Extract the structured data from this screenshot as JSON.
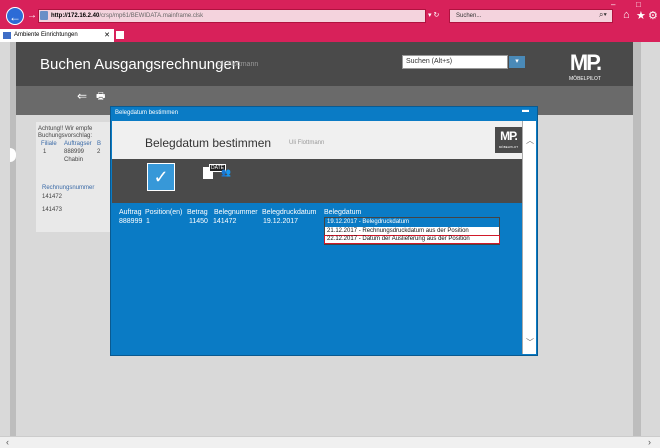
{
  "browser": {
    "address_host": "http://172.16.2.40",
    "address_path": "/crsp/mp61/BEWIDATA.mainframe.clsk",
    "search_placeholder": "Suchen...",
    "tab_title": "Ambiente Einrichtungen"
  },
  "app": {
    "title": "Buchen Ausgangsrechnungen",
    "user": "Uli Flottmann",
    "search_placeholder": "Suchen (Alt+s)",
    "logo_text": "MP.",
    "logo_sub": "MÖBELPILOT"
  },
  "background_form": {
    "warning_line1": "Achtung!! Wir empfe",
    "warning_line2": "Buchungsvorschlag:",
    "headers": [
      "Filiale",
      "Auftragser",
      "B"
    ],
    "row": [
      "1",
      "888999",
      "2"
    ],
    "name": "Chabin",
    "section_header": "Rechnungsnummer",
    "numbers": [
      "141472",
      "141473"
    ]
  },
  "modal": {
    "window_title": "Belegdatum bestimmen",
    "heading": "Belegdatum bestimmen",
    "user": "Uli Flottmann",
    "logo_text": "MP.",
    "doc_date_label": "DATE",
    "columns": [
      "Auftrag",
      "Position(en)",
      "Betrag",
      "Belegnummer",
      "Belegdruckdatum",
      "Belegdatum"
    ],
    "values": [
      "888999",
      "1",
      "11450",
      "141472",
      "19.12.2017"
    ],
    "dropdown_options": [
      "19.12.2017 - Belegdruckdatum",
      "21.12.2017 - Rechnungsdruckdatum aus der Position",
      "22.12.2017 - Datum der Auslieferung aus der Position"
    ]
  },
  "colors": {
    "browser_accent": "#d8215a",
    "modal_blue": "#0a7bc5",
    "app_dark": "#4a4a4a",
    "highlight_red": "#d01a2a"
  }
}
